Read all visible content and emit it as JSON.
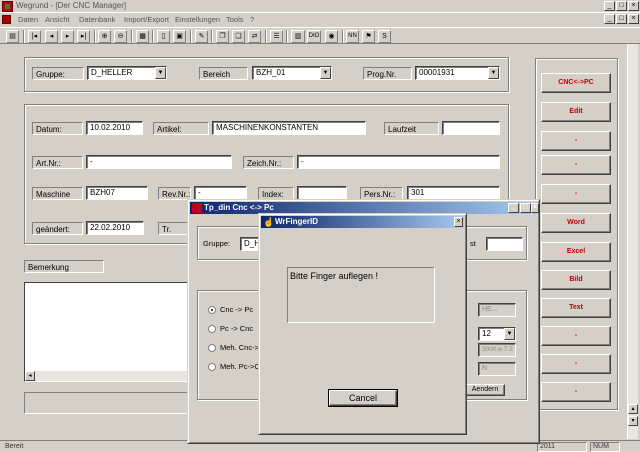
{
  "app": {
    "title": "Wegrund - [Der CNC Manager]"
  },
  "menu": [
    "Daten",
    "Ansicht",
    "Datenbank",
    "Import/Export",
    "Einstellungen",
    "Tools",
    "?"
  ],
  "toolbar": {
    "icons": [
      "print-icon",
      "first-record-icon",
      "prev-record-icon",
      "play-icon",
      "next-record-icon",
      "last-record-icon",
      "zoom-in-icon",
      "zoom-out-icon",
      "grid-icon",
      "new-icon",
      "save-icon",
      "edit-icon",
      "copy-icon",
      "paste-icon",
      "compare-icon",
      "list-icon",
      "table-icon",
      "dio-icon",
      "view-icon",
      "settings-icon",
      "nn-icon",
      "abc-icon",
      "s-icon"
    ],
    "dio_label": "DIO",
    "nn_label": "NN",
    "s_label": "S"
  },
  "form": {
    "gruppe_label": "Gruppe:",
    "gruppe_value": "D_HELLER",
    "bereich_label": "Bereich",
    "bereich_value": "BZH_01",
    "prognr_label": "Prog.Nr.",
    "prognr_value": "00001931",
    "datum_label": "Datum:",
    "datum_value": "10.02.2010",
    "artikel_label": "Artikel:",
    "artikel_value": "MASCHINENKONSTANTEN",
    "laufzeit_label": "Laufzeit",
    "laufzeit_value": "",
    "artnr_label": "Art.Nr.:",
    "artnr_value": "-",
    "zeichnr_label": "Zeich.Nr.:",
    "zeichnr_value": "-",
    "maschine_label": "Maschine",
    "maschine_value": "BZH07",
    "revnr_label": "Rev.Nr.:",
    "revnr_value": "-",
    "index_label": "Index:",
    "index_value": "",
    "persnr_label": "Pers.Nr.:",
    "persnr_value": "301",
    "geaendert_label": "geändert:",
    "geaendert_value": "22.02.2010",
    "tr_label": "Tr.",
    "bemerkung_label": "Bemerkung"
  },
  "right_buttons": [
    "CNC<->PC",
    "Edit",
    "-",
    "-",
    "-",
    "Word",
    "Excel",
    "Bild",
    "Text",
    "-",
    "-",
    "-"
  ],
  "statusbar": {
    "left": "Bereit",
    "year": "2011",
    "num": "NUM"
  },
  "transfer_dialog": {
    "title": "Tp_din    Cnc <-> Pc",
    "gruppe_label": "Gruppe:",
    "gruppe_value": "D_HI",
    "options": [
      "Cnc -> Pc",
      "Pc -> Cnc",
      "Meh. Cnc->P",
      "Meh. Pc->Cn"
    ],
    "right_label": "st",
    "hb_value": "HE...",
    "combo_value": "12",
    "field_value": "3000.e.7.2",
    "n_value": "N",
    "aendern_button": "Aendern"
  },
  "finger_dialog": {
    "title": "WrFingerID",
    "message": "Bitte Finger auflegen !",
    "cancel_button": "Cancel"
  }
}
